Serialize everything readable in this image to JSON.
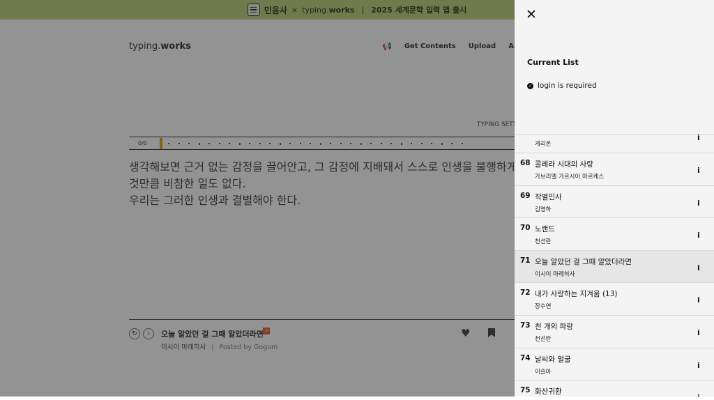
{
  "banner": {
    "brand1": "민음사",
    "x": "×",
    "brand2_prefix": "typing.",
    "brand2_bold": "works",
    "separator": "|",
    "promo": "2025 세계문학 입력 앱 출시"
  },
  "header": {
    "logo_prefix": "typing.",
    "logo_bold": "works",
    "nav": [
      "Get Contents",
      "Upload",
      "Archiv"
    ]
  },
  "typing": {
    "settings_label": "TYPING SETTII",
    "progress": "0/0",
    "passage": [
      "생각해보면 근거 없는 감정을 끌어안고, 그 감정에 지배돼서 스스로 인생을 불행하게",
      "것만큼 비참한 일도 없다.",
      "우리는 그러한 인생과 결별해야 한다."
    ]
  },
  "work": {
    "title": "오늘 알았던 걸 그때 알았더라면",
    "author": "이시이 마레히사",
    "separator": "|",
    "posted_by": "Posted by Gogum"
  },
  "panel": {
    "heading": "Current List",
    "notice": "login is required",
    "items": [
      {
        "num": "",
        "title": "",
        "author": "게리온",
        "partial": true
      },
      {
        "num": "68",
        "title": "콜레라 시대의 사랑",
        "author": "가브리엘 가르시아 마르케스"
      },
      {
        "num": "69",
        "title": "작별인사",
        "author": "김영하"
      },
      {
        "num": "70",
        "title": "노랜드",
        "author": "천선란"
      },
      {
        "num": "71",
        "title": "오늘 알았던 걸 그때 알았더라면",
        "author": "이시이 마레히사",
        "active": true
      },
      {
        "num": "72",
        "title": "내가 사랑하는 지겨움 (13)",
        "author": "장수연"
      },
      {
        "num": "73",
        "title": "천 개의 파랑",
        "author": "천선란"
      },
      {
        "num": "74",
        "title": "날씨와 얼굴",
        "author": "이슬아"
      },
      {
        "num": "75",
        "title": "화산귀환",
        "author": ""
      }
    ],
    "info_label": "i"
  }
}
